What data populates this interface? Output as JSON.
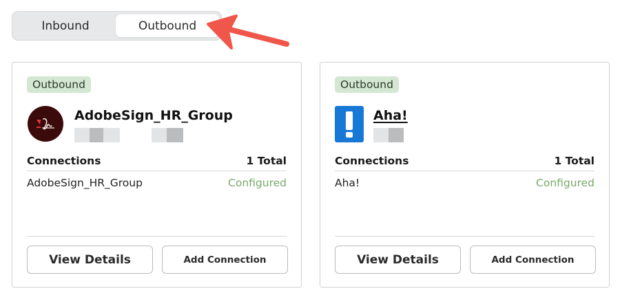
{
  "toggle": {
    "inbound_label": "Inbound",
    "outbound_label": "Outbound",
    "selected": "Outbound"
  },
  "annotation": {
    "arrow_color": "#f0564a"
  },
  "colors": {
    "badge_bg": "#d3e7d2",
    "status_configured": "#7aa86a",
    "aha_blue": "#1878d6",
    "adobe_dark": "#3b0a0a"
  },
  "cards": [
    {
      "badge": "Outbound",
      "app_name": "AdobeSign_HR_Group",
      "icon": "adobe-sign-icon",
      "connections_label": "Connections",
      "total": "1 Total",
      "connections": [
        {
          "name": "AdobeSign_HR_Group",
          "status": "Configured"
        }
      ],
      "view_label": "View Details",
      "add_label": "Add Connection"
    },
    {
      "badge": "Outbound",
      "app_name": "Aha!",
      "icon": "aha-exclamation-icon",
      "connections_label": "Connections",
      "total": "1 Total",
      "connections": [
        {
          "name": "Aha!",
          "status": "Configured"
        }
      ],
      "view_label": "View Details",
      "add_label": "Add Connection"
    }
  ]
}
